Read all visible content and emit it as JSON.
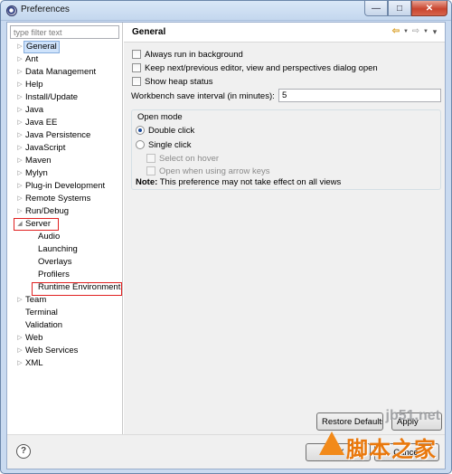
{
  "window": {
    "title": "Preferences",
    "minimize_glyph": "—",
    "maximize_glyph": "□",
    "close_glyph": "✕"
  },
  "filter": {
    "placeholder": "type filter text"
  },
  "tree": {
    "items": [
      {
        "label": "General",
        "arrow": "▷",
        "level": 0,
        "selected": true
      },
      {
        "label": "Ant",
        "arrow": "▷",
        "level": 0
      },
      {
        "label": "Data Management",
        "arrow": "▷",
        "level": 0
      },
      {
        "label": "Help",
        "arrow": "▷",
        "level": 0
      },
      {
        "label": "Install/Update",
        "arrow": "▷",
        "level": 0
      },
      {
        "label": "Java",
        "arrow": "▷",
        "level": 0
      },
      {
        "label": "Java EE",
        "arrow": "▷",
        "level": 0
      },
      {
        "label": "Java Persistence",
        "arrow": "▷",
        "level": 0
      },
      {
        "label": "JavaScript",
        "arrow": "▷",
        "level": 0
      },
      {
        "label": "Maven",
        "arrow": "▷",
        "level": 0
      },
      {
        "label": "Mylyn",
        "arrow": "▷",
        "level": 0
      },
      {
        "label": "Plug-in Development",
        "arrow": "▷",
        "level": 0
      },
      {
        "label": "Remote Systems",
        "arrow": "▷",
        "level": 0
      },
      {
        "label": "Run/Debug",
        "arrow": "▷",
        "level": 0
      },
      {
        "label": "Server",
        "arrow": "◢",
        "level": 0
      },
      {
        "label": "Audio",
        "arrow": "",
        "level": 1
      },
      {
        "label": "Launching",
        "arrow": "",
        "level": 1
      },
      {
        "label": "Overlays",
        "arrow": "",
        "level": 1
      },
      {
        "label": "Profilers",
        "arrow": "",
        "level": 1
      },
      {
        "label": "Runtime Environment",
        "arrow": "",
        "level": 1
      },
      {
        "label": "Team",
        "arrow": "▷",
        "level": 0
      },
      {
        "label": "Terminal",
        "arrow": "",
        "level": 0
      },
      {
        "label": "Validation",
        "arrow": "",
        "level": 0
      },
      {
        "label": "Web",
        "arrow": "▷",
        "level": 0
      },
      {
        "label": "Web Services",
        "arrow": "▷",
        "level": 0
      },
      {
        "label": "XML",
        "arrow": "▷",
        "level": 0
      }
    ]
  },
  "panel": {
    "title": "General",
    "nav": {
      "back": "⇦",
      "forward": "⇨",
      "dropdown": "▼",
      "menu": "▾"
    },
    "options": {
      "always_run_background": "Always run in background",
      "keep_next_prev": "Keep next/previous editor, view and perspectives dialog open",
      "show_heap": "Show heap status"
    },
    "interval": {
      "label": "Workbench save interval (in minutes):",
      "value": "5"
    },
    "open_mode": {
      "title": "Open mode",
      "double_click": "Double click",
      "single_click": "Single click",
      "select_on_hover": "Select on hover",
      "open_arrow_keys": "Open when using arrow keys",
      "note_bold": "Note:",
      "note_text": " This preference may not take effect on all views"
    },
    "restore_defaults": "Restore Defaults",
    "apply": "Apply"
  },
  "bottom": {
    "help": "?",
    "ok": "OK",
    "cancel": "Cancel"
  },
  "watermark": {
    "url": "jb51.net",
    "text": "脚本之家"
  }
}
